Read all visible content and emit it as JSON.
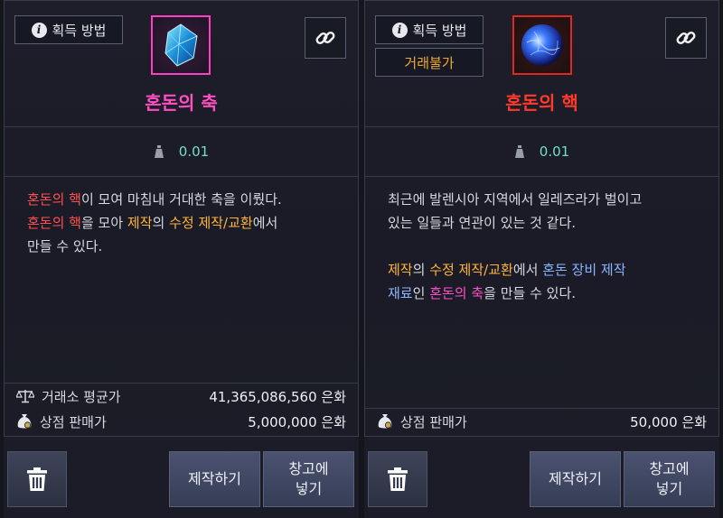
{
  "left": {
    "acquisition_label": "획득 방법",
    "item_name": "혼돈의 축",
    "item_name_color": "#ff4fc0",
    "weight": "0.01",
    "desc_lines": [
      [
        {
          "t": "혼돈의 핵",
          "c": "red"
        },
        {
          "t": "이 모여 마침내 거대한 축을 이뤘다.",
          "c": ""
        }
      ],
      [
        {
          "t": "혼돈의 핵",
          "c": "red"
        },
        {
          "t": "을 모아 ",
          "c": ""
        },
        {
          "t": "제작",
          "c": "orange"
        },
        {
          "t": "의 ",
          "c": ""
        },
        {
          "t": "수정 제작/교환",
          "c": "orange"
        },
        {
          "t": "에서",
          "c": ""
        }
      ],
      [
        {
          "t": "만들 수 있다.",
          "c": ""
        }
      ]
    ],
    "prices": [
      {
        "label": "거래소 평균가",
        "value": "41,365,086,560 은화",
        "icon": "scales-icon"
      },
      {
        "label": "상점 판매가",
        "value": "5,000,000 은화",
        "icon": "money-bag-icon"
      }
    ],
    "craft_label": "제작하기",
    "storage_label": "창고에\n넣기"
  },
  "right": {
    "acquisition_label": "획득 방법",
    "trade_label": "거래불가",
    "item_name": "혼돈의 핵",
    "item_name_color": "#ff3a2a",
    "weight": "0.01",
    "desc_lines": [
      [
        {
          "t": "최근에 발렌시아 지역에서 일레즈라가 벌이고",
          "c": ""
        }
      ],
      [
        {
          "t": "있는 일들과 연관이 있는 것 같다.",
          "c": ""
        }
      ],
      [],
      [
        {
          "t": "제작",
          "c": "orange"
        },
        {
          "t": "의 ",
          "c": ""
        },
        {
          "t": "수정 제작/교환",
          "c": "orange"
        },
        {
          "t": "에서 ",
          "c": ""
        },
        {
          "t": "혼돈 장비 제작",
          "c": "blue"
        }
      ],
      [
        {
          "t": "재료",
          "c": "blue"
        },
        {
          "t": "인 ",
          "c": ""
        },
        {
          "t": "혼돈의 축",
          "c": "pink"
        },
        {
          "t": "을 만들 수 있다.",
          "c": ""
        }
      ]
    ],
    "prices": [
      {
        "label": "상점 판매가",
        "value": "50,000 은화",
        "icon": "money-bag-icon"
      }
    ],
    "craft_label": "제작하기",
    "storage_label": "창고에\n넣기"
  }
}
